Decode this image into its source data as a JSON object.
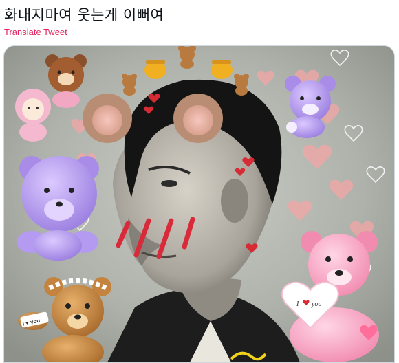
{
  "tweet": {
    "text": "화내지마여 웃는게 이뻐여",
    "translate_label": "Translate Tweet"
  },
  "media": {
    "sticker_captions": {
      "left_bear": "I ♥ you",
      "right_bear_line1": "I",
      "right_bear_line2": "you"
    }
  },
  "colors": {
    "translate_link": "#e0245e",
    "text": "#0f1419",
    "blush": "#d92a3a"
  }
}
